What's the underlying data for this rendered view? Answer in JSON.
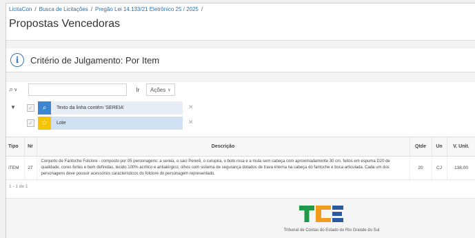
{
  "breadcrumb": {
    "items": [
      "LicitaCon",
      "Busca de Licitações",
      "Pregão Lei 14.133/21 Eletrônico 25 / 2025"
    ],
    "trailing": "/"
  },
  "page_title": "Propostas Vencedoras",
  "criterio": {
    "icon": "info-icon",
    "text": "Critério de Julgamento: Por Item"
  },
  "toolbar": {
    "search_placeholder": "",
    "go_label": "Ir",
    "actions_label": "Ações"
  },
  "filters": [
    {
      "icon": "search-icon",
      "label": "Texto da linha contém 'SEREIA'",
      "color": "#3b86d1"
    },
    {
      "icon": "star-icon",
      "label": "Lote",
      "color": "#f5c400"
    }
  ],
  "table": {
    "headers": {
      "tipo": "Tipo",
      "nr": "Nr",
      "descricao": "Descrição",
      "qtde": "Qtde",
      "un": "Un",
      "vunit": "V. Unit."
    },
    "rows": [
      {
        "tipo": "ITEM",
        "nr": "27",
        "descricao": "Conjunto de Fantoche Folclore - composto por 05 personagens: a sereia, o saci Pererê, o curupira, o boto rosa e a mula sem cabeça com aproximadamente 30 cm, feitos em espuma D20 de qualidade, cores fortes e bem definidas, tecido 100% acrílico e antialérgico, olhos com sistema de segurança dotados de trava interna na cabeça do fantoche e boca articulada. Cada um dos personagens deve possuir acessórios característicos do folclore do personagem representado.",
        "qtde": "20",
        "un": "CJ",
        "vunit": "138,00"
      }
    ]
  },
  "pagination": "1 - 1 de 1",
  "footer": {
    "org": "Tribunal de Contas do Estado do Rio Grande do Sul",
    "logo_colors": {
      "green": "#1f9a48",
      "orange": "#f29c1f",
      "blue": "#2c5aa0"
    }
  }
}
